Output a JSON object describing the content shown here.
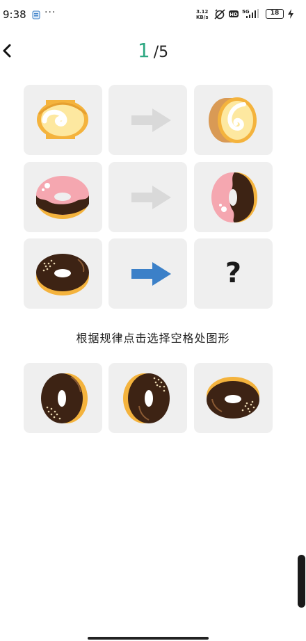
{
  "status_bar": {
    "time": "9:38",
    "more": "···",
    "speed_value": "3.12",
    "speed_unit": "KB/s",
    "hd": "HD",
    "network": "5G",
    "battery": "18"
  },
  "header": {
    "current_question": "1",
    "total_questions": "/5"
  },
  "puzzle": {
    "rows": [
      {
        "source": "swiss-roll-icon",
        "arrow": "gray-arrow-icon",
        "result": "swiss-roll-rotated-icon"
      },
      {
        "source": "pink-donut-icon",
        "arrow": "gray-arrow-icon",
        "result": "pink-donut-rotated-icon"
      },
      {
        "source": "chocolate-donut-icon",
        "arrow": "blue-arrow-icon",
        "result": "?"
      }
    ]
  },
  "instruction": "根据规律点击选择空格处图形",
  "options": [
    "chocolate-donut-option-a",
    "chocolate-donut-option-b",
    "chocolate-donut-option-c"
  ],
  "colors": {
    "accent": "#2ea882",
    "tile_bg": "#efefef",
    "active_arrow": "#3b80c8",
    "inactive_arrow": "#d9d9d9",
    "chocolate": "#3d2314",
    "dough": "#f4b33d",
    "icing_pink": "#f5a7b0",
    "sponge": "#fde8a0"
  }
}
